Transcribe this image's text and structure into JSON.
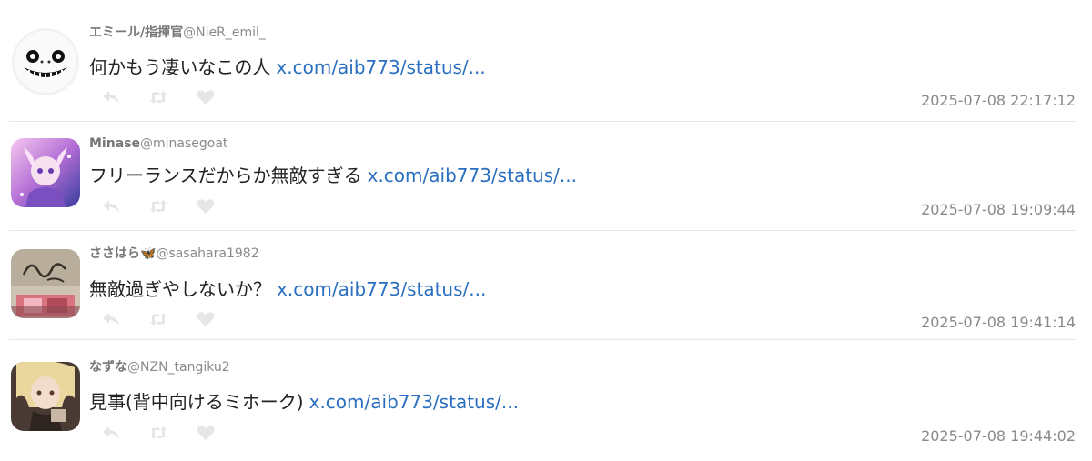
{
  "tweets": [
    {
      "name": "エミール/指揮官",
      "handle": "@NieR_emil_",
      "text": "何かもう凄いなこの人",
      "link": "x.com/aib773/status/...",
      "timestamp": "2025-07-08 22:17:12"
    },
    {
      "name": "Minase",
      "handle": "@minasegoat",
      "text": "フリーランスだからか無敵すぎる",
      "link": "x.com/aib773/status/...",
      "timestamp": "2025-07-08 19:09:44"
    },
    {
      "name": "ささはら🦋",
      "handle": "@sasahara1982",
      "text": "無敵過ぎやしないか？",
      "link": "x.com/aib773/status/...",
      "timestamp": "2025-07-08 19:41:14"
    },
    {
      "name": "なずな",
      "handle": "@NZN_tangiku2",
      "text": "見事(背中向けるミホーク)",
      "link": "x.com/aib773/status/...",
      "timestamp": "2025-07-08 19:44:02"
    }
  ],
  "icons": {
    "reply": "reply-icon",
    "retweet": "retweet-icon",
    "like": "heart-icon"
  },
  "colors": {
    "link": "#2a6fbf",
    "icon": "#e6e6e6",
    "meta_text": "#8a8a8a"
  }
}
